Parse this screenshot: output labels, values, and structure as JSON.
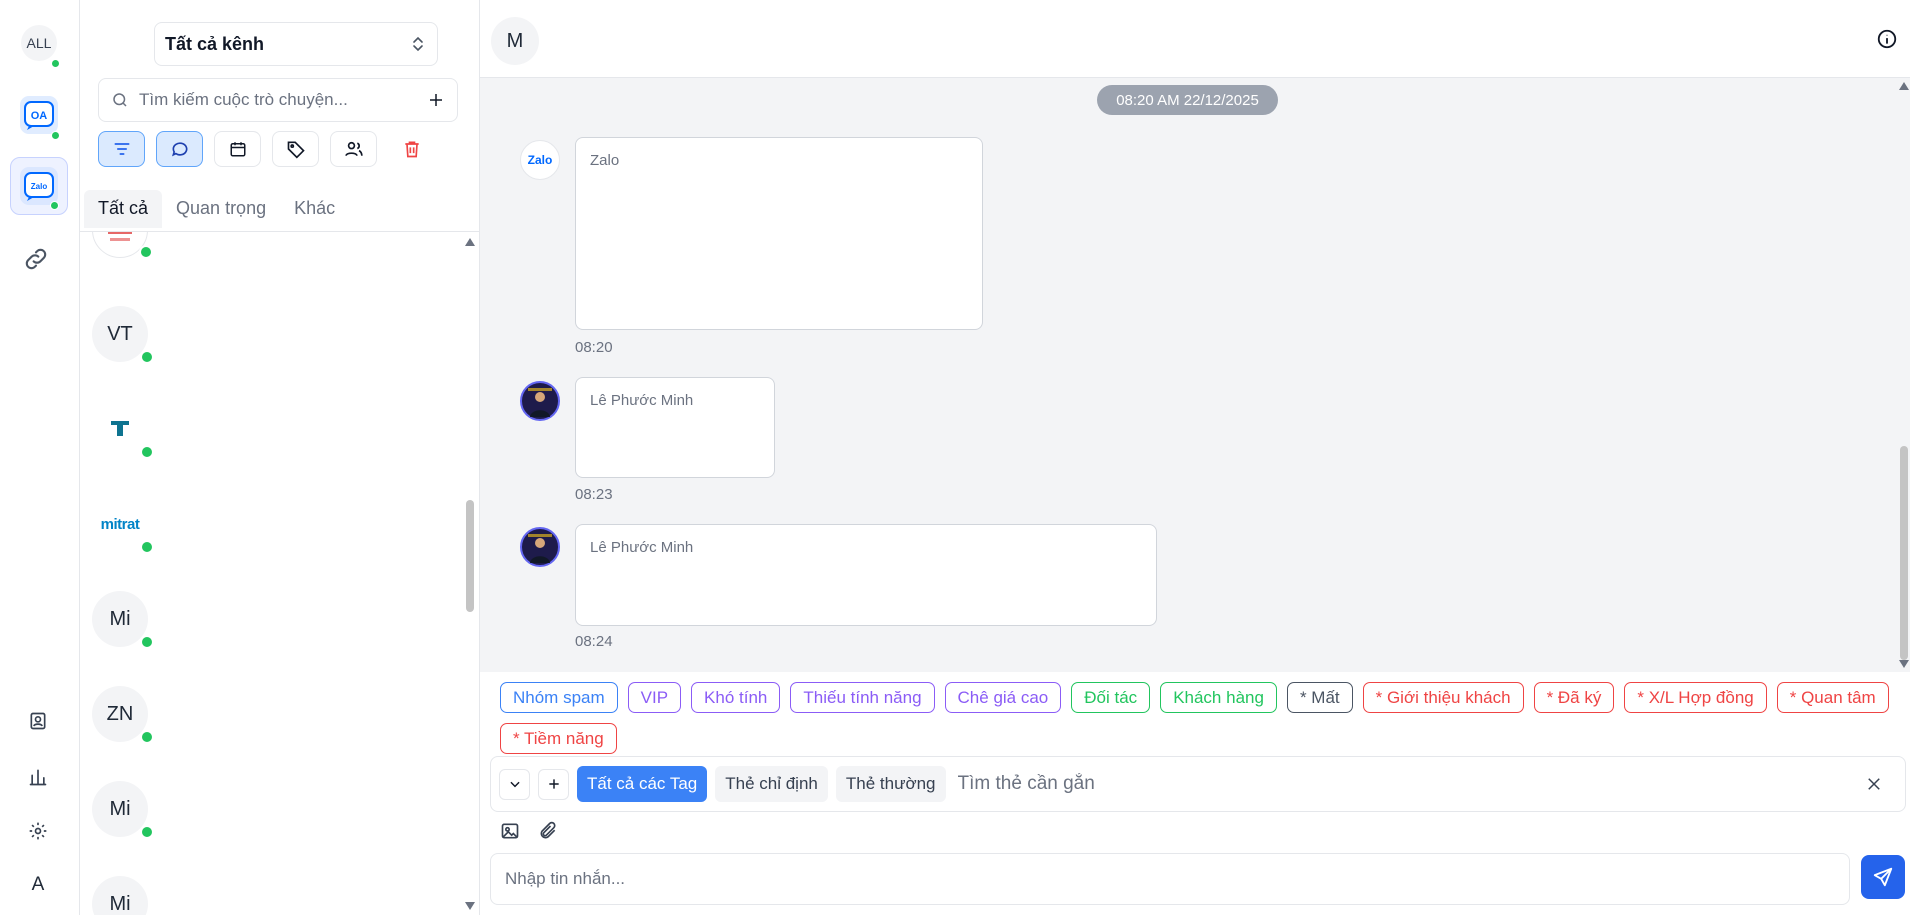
{
  "rail": {
    "all_label": "ALL",
    "oa_label": "OA",
    "zalo_label": "Zalo",
    "user_initial": "A"
  },
  "panel": {
    "channel_select": "Tất cả kênh",
    "search_placeholder": "Tìm kiếm cuộc trò chuyện...",
    "tabs": [
      {
        "label": "Tất cả",
        "active": true
      },
      {
        "label": "Quan trọng",
        "active": false
      },
      {
        "label": "Khác",
        "active": false
      }
    ],
    "conversations": [
      {
        "initials": ""
      },
      {
        "initials": "VT"
      },
      {
        "initials": "T"
      },
      {
        "initials": "mitrat"
      },
      {
        "initials": "Mi"
      },
      {
        "initials": "ZN"
      },
      {
        "initials": "Mi"
      },
      {
        "initials": "Mi"
      }
    ]
  },
  "chat": {
    "header_initial": "M",
    "date_pill": "08:20 AM 22/12/2025",
    "messages": [
      {
        "sender": "Zalo",
        "avatar_text": "Zalo",
        "time": "08:20"
      },
      {
        "sender": "Lê Phước Minh",
        "time": "08:23"
      },
      {
        "sender": "Lê Phước Minh",
        "time": "08:24"
      }
    ],
    "tags": [
      {
        "label": "Nhóm spam",
        "color": "#3b82f6"
      },
      {
        "label": "VIP",
        "color": "#8b5cf6"
      },
      {
        "label": "Khó tính",
        "color": "#8b5cf6"
      },
      {
        "label": "Thiếu tính năng",
        "color": "#8b5cf6"
      },
      {
        "label": "Chê giá cao",
        "color": "#8b5cf6"
      },
      {
        "label": "Đối tác",
        "color": "#22c55e"
      },
      {
        "label": "Khách hàng",
        "color": "#22c55e"
      },
      {
        "label": "* Mất",
        "color": "#4b5563"
      },
      {
        "label": "* Giới thiệu khách",
        "color": "#ef4444"
      },
      {
        "label": "* Đã ký",
        "color": "#ef4444"
      },
      {
        "label": "* X/L Hợp đồng",
        "color": "#ef4444"
      },
      {
        "label": "* Quan tâm",
        "color": "#ef4444"
      },
      {
        "label": "* Tiềm năng",
        "color": "#ef4444"
      }
    ],
    "tag_filters": [
      "Tất cả các Tag",
      "Thẻ chỉ định",
      "Thẻ thường"
    ],
    "tag_search_placeholder": "Tìm thẻ cần gắn",
    "composer_placeholder": "Nhập tin nhắn..."
  },
  "colors": {
    "accent": "#3b82f6",
    "online": "#22c55e",
    "danger": "#ef4444"
  }
}
